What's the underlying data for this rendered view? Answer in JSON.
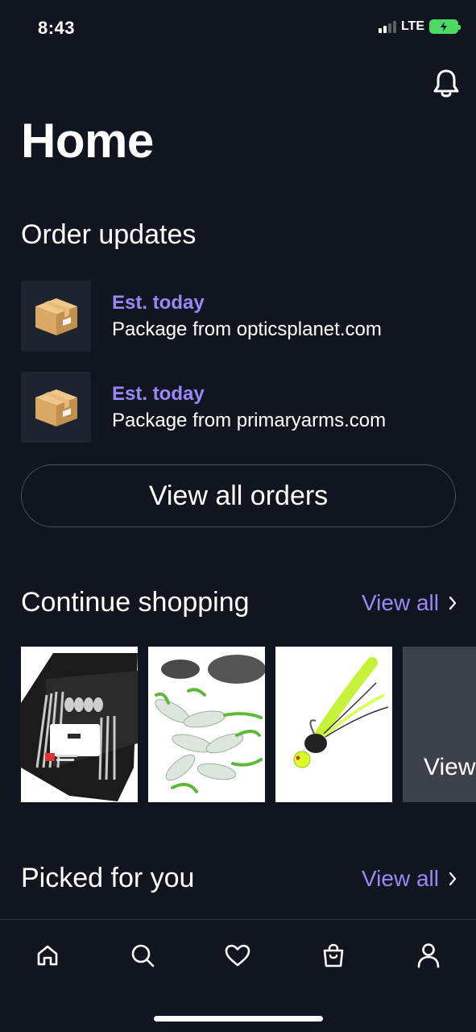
{
  "status": {
    "time": "8:43",
    "network": "LTE"
  },
  "header": {
    "title": "Home",
    "icon": "bell-icon"
  },
  "orders": {
    "section_title": "Order updates",
    "items": [
      {
        "eta": "Est. today",
        "description": "Package from opticsplanet.com",
        "icon": "package-box-icon"
      },
      {
        "eta": "Est. today",
        "description": "Package from primaryarms.com",
        "icon": "package-box-icon"
      }
    ],
    "view_all_label": "View all orders"
  },
  "continue_shopping": {
    "section_title": "Continue shopping",
    "view_all_label": "View all",
    "items": [
      {
        "image": "utensil-roll-kit"
      },
      {
        "image": "soft-plastic-grubs"
      },
      {
        "image": "chartreuse-fishing-jig"
      }
    ],
    "more_label": "View"
  },
  "picked_for_you": {
    "section_title": "Picked for you",
    "view_all_label": "View all"
  },
  "tab_bar": {
    "items": [
      "home-icon",
      "search-icon",
      "heart-icon",
      "shopping-bag-icon",
      "profile-icon"
    ]
  },
  "colors": {
    "background": "#11151f",
    "accent": "#9b87f5",
    "surface": "#1e2330"
  }
}
